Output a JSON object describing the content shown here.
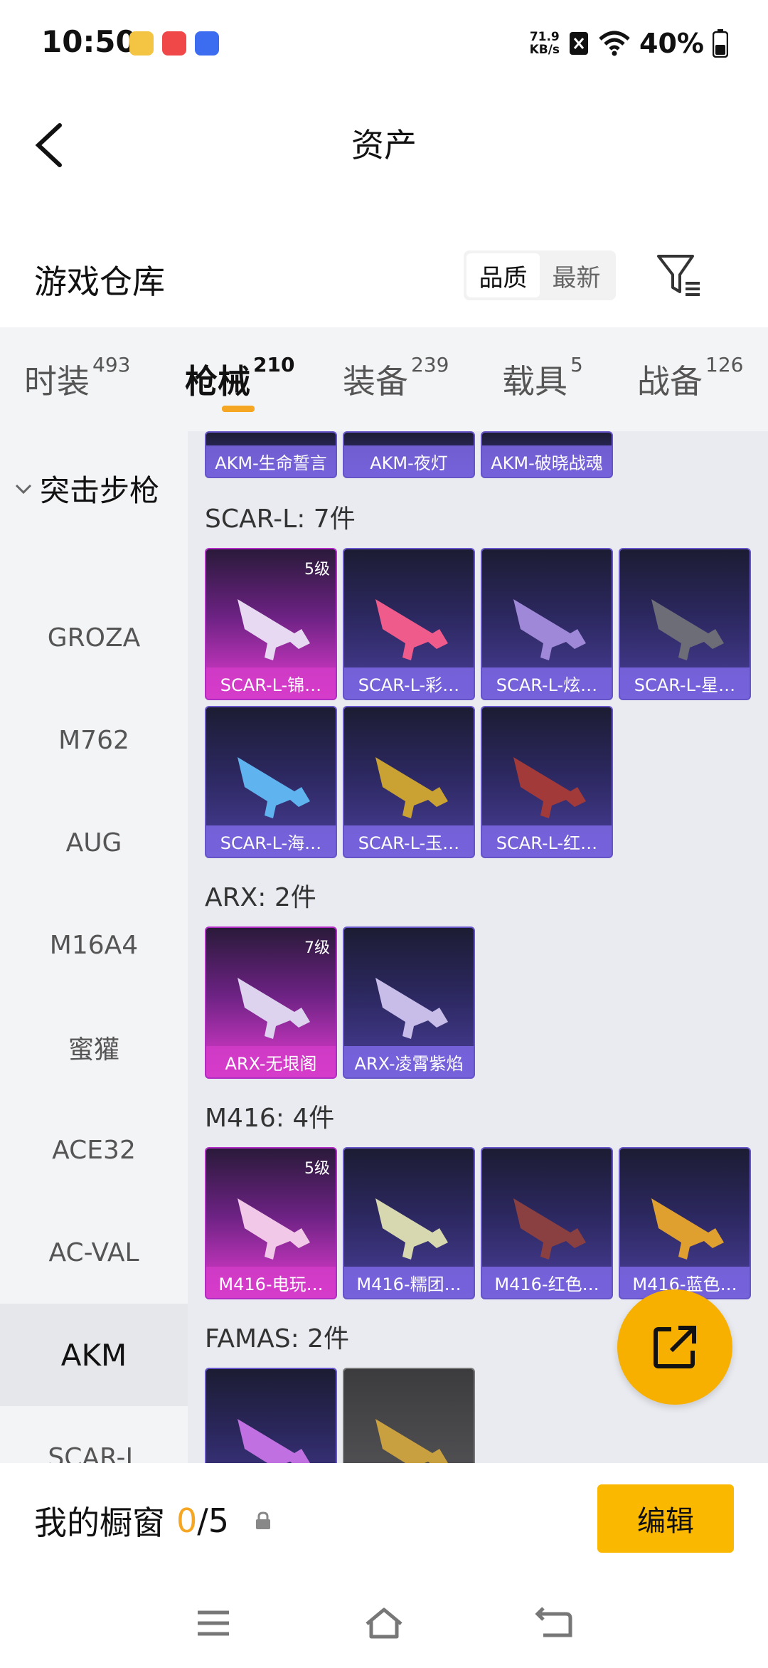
{
  "status_bar": {
    "time": "10:50",
    "net_speed_value": "71.9",
    "net_speed_unit": "KB/s",
    "battery": "40%"
  },
  "header": {
    "title": "资产"
  },
  "warehouse": {
    "title": "游戏仓库",
    "sort_options": [
      "品质",
      "最新"
    ],
    "active_sort": "品质"
  },
  "tabs": [
    {
      "label": "时装",
      "count": "493"
    },
    {
      "label": "枪械",
      "count": "210"
    },
    {
      "label": "装备",
      "count": "239"
    },
    {
      "label": "载具",
      "count": "5"
    },
    {
      "label": "战备",
      "count": "126"
    }
  ],
  "active_tab": "枪械",
  "sidebar": {
    "header": "突击步枪",
    "items": [
      "GROZA",
      "M762",
      "AUG",
      "M16A4",
      "蜜獾",
      "ACE32",
      "AC-VAL",
      "AKM",
      "SCAR-L"
    ],
    "active": "AKM"
  },
  "sections": {
    "akm_partial": [
      "AKM-生命誓言",
      "AKM-夜灯",
      "AKM-破晓战魂"
    ],
    "scar": {
      "title": "SCAR-L: 7件",
      "items": [
        {
          "name": "SCAR-L-锦…",
          "level": "5级"
        },
        {
          "name": "SCAR-L-彩…"
        },
        {
          "name": "SCAR-L-炫…"
        },
        {
          "name": "SCAR-L-星…"
        },
        {
          "name": "SCAR-L-海…"
        },
        {
          "name": "SCAR-L-玉…"
        },
        {
          "name": "SCAR-L-红…"
        }
      ]
    },
    "arx": {
      "title": "ARX: 2件",
      "items": [
        {
          "name": "ARX-无垠阁",
          "level": "7级"
        },
        {
          "name": "ARX-凌霄紫焰"
        }
      ]
    },
    "m416": {
      "title": "M416: 4件",
      "items": [
        {
          "name": "M416-电玩…",
          "level": "5级"
        },
        {
          "name": "M416-糯团…"
        },
        {
          "name": "M416-红色…"
        },
        {
          "name": "M416-蓝色…"
        }
      ]
    },
    "famas": {
      "title": "FAMAS: 2件"
    }
  },
  "showcase": {
    "label": "我的橱窗",
    "current": "0",
    "total": "/5",
    "edit_label": "编辑"
  },
  "colors": {
    "accent": "#fbb800",
    "tab_underline": "#f5a623",
    "card_purple": "#4a3f9a",
    "card_pink": "#e63dd3"
  }
}
